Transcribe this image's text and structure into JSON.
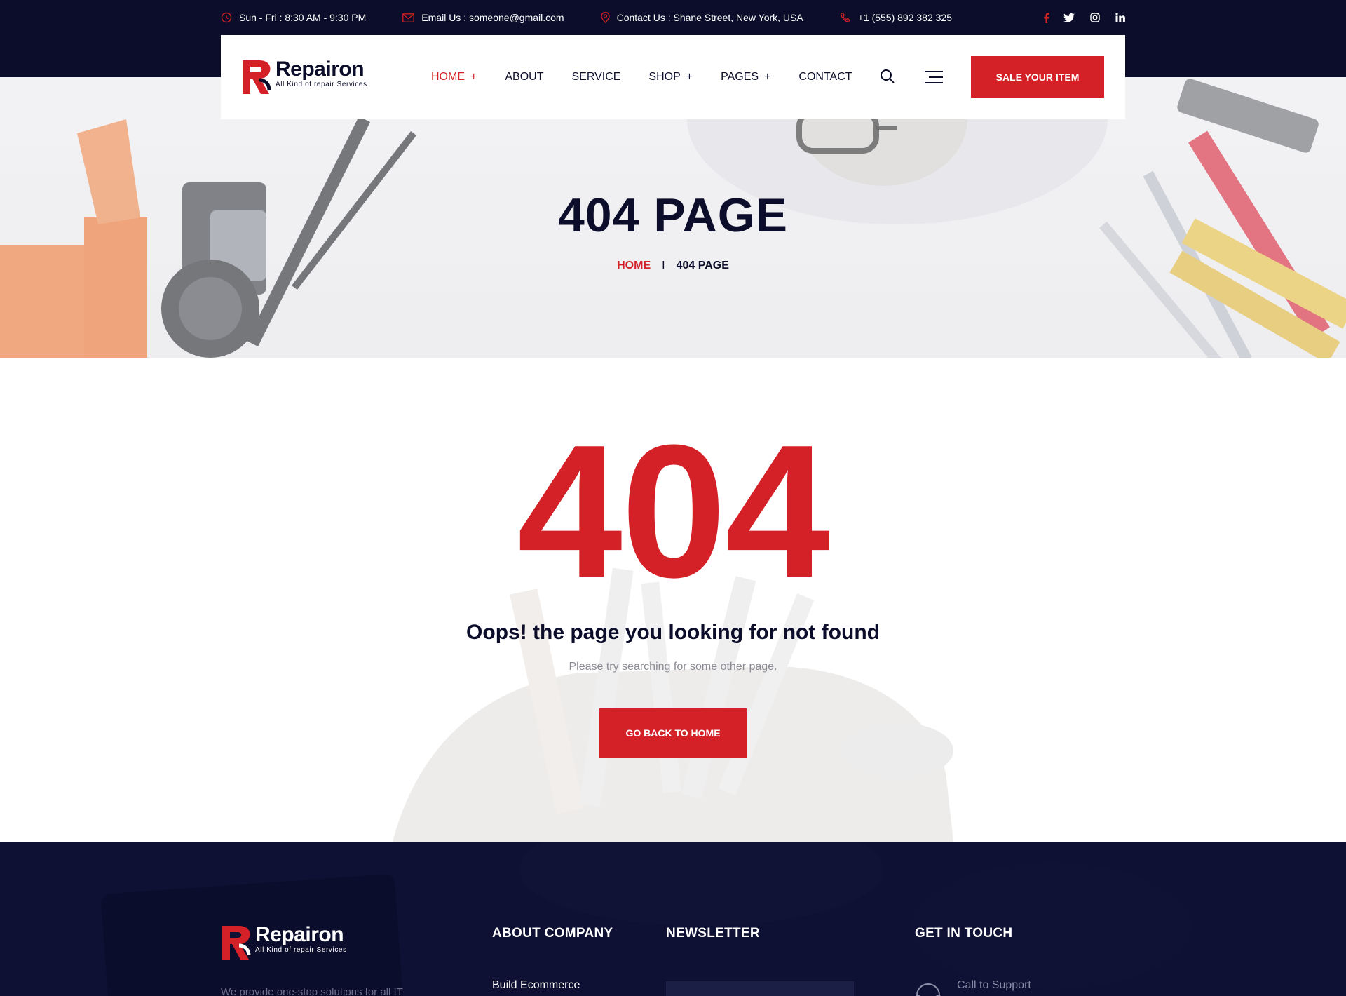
{
  "topbar": {
    "hours": "Sun - Fri : 8:30 AM - 9:30 PM",
    "email": "Email Us : someone@gmail.com",
    "address": "Contact Us : Shane Street, New York, USA",
    "phone": "+1 (555) 892 382 325",
    "socials": [
      "facebook-icon",
      "twitter-icon",
      "instagram-icon",
      "linkedin-icon"
    ]
  },
  "header": {
    "logo_name": "Repairon",
    "logo_tagline": "All Kind of repair Services",
    "nav": [
      {
        "label": "HOME",
        "has_submenu": true,
        "active": true
      },
      {
        "label": "ABOUT",
        "has_submenu": false
      },
      {
        "label": "SERVICE",
        "has_submenu": false
      },
      {
        "label": "SHOP",
        "has_submenu": true
      },
      {
        "label": "PAGES",
        "has_submenu": true
      },
      {
        "label": "CONTACT",
        "has_submenu": false
      }
    ],
    "submenu_mark": "+",
    "cta": "SALE YOUR ITEM"
  },
  "hero": {
    "title": "404 PAGE",
    "breadcrumb_home": "HOME",
    "breadcrumb_sep": "I",
    "breadcrumb_current": "404 PAGE"
  },
  "error": {
    "code": "404",
    "heading": "Oops! the page you looking for not found",
    "message": "Please try searching for some other page.",
    "button": "GO BACK TO HOME"
  },
  "footer": {
    "logo_name": "Repairon",
    "logo_tagline": "All Kind of repair Services",
    "description": "We provide one-stop solutions for all IT",
    "about_heading": "ABOUT COMPANY",
    "about_link": "Build  Ecommerce",
    "newsletter_heading": "NEWSLETTER",
    "contact_heading": "GET IN TOUCH",
    "support_label": "Call to Support"
  },
  "colors": {
    "accent": "#d42027",
    "navy": "#0b0d2a",
    "footer_bg": "#0e1133"
  }
}
